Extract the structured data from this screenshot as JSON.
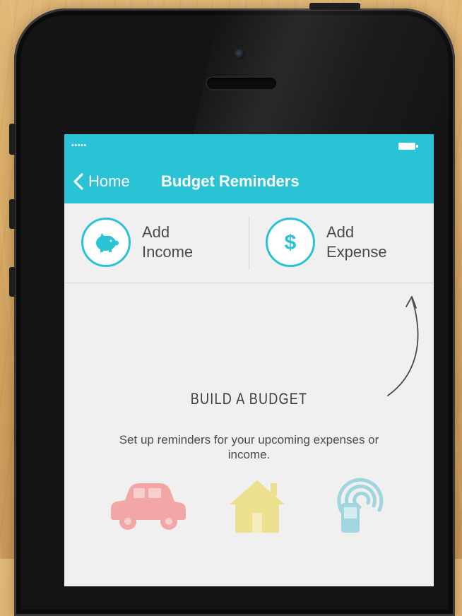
{
  "status_bar": {
    "signal": "•••••"
  },
  "nav": {
    "back_label": "Home",
    "title": "Budget Reminders"
  },
  "actions": [
    {
      "line1": "Add",
      "line2": "Income",
      "icon": "piggy-bank-icon"
    },
    {
      "line1": "Add",
      "line2": "Expense",
      "icon": "dollar-icon"
    }
  ],
  "empty_state": {
    "title": "BUILD A BUDGET",
    "description": "Set up reminders for your upcoming expenses or income.",
    "illustrations": [
      "car-icon",
      "house-icon",
      "mobile-phone-icon"
    ]
  },
  "colors": {
    "accent": "#29c3d5",
    "background": "#eff0ef",
    "car": "#f2a6a6",
    "house": "#ecdf8e",
    "phone": "#9fd6df"
  }
}
